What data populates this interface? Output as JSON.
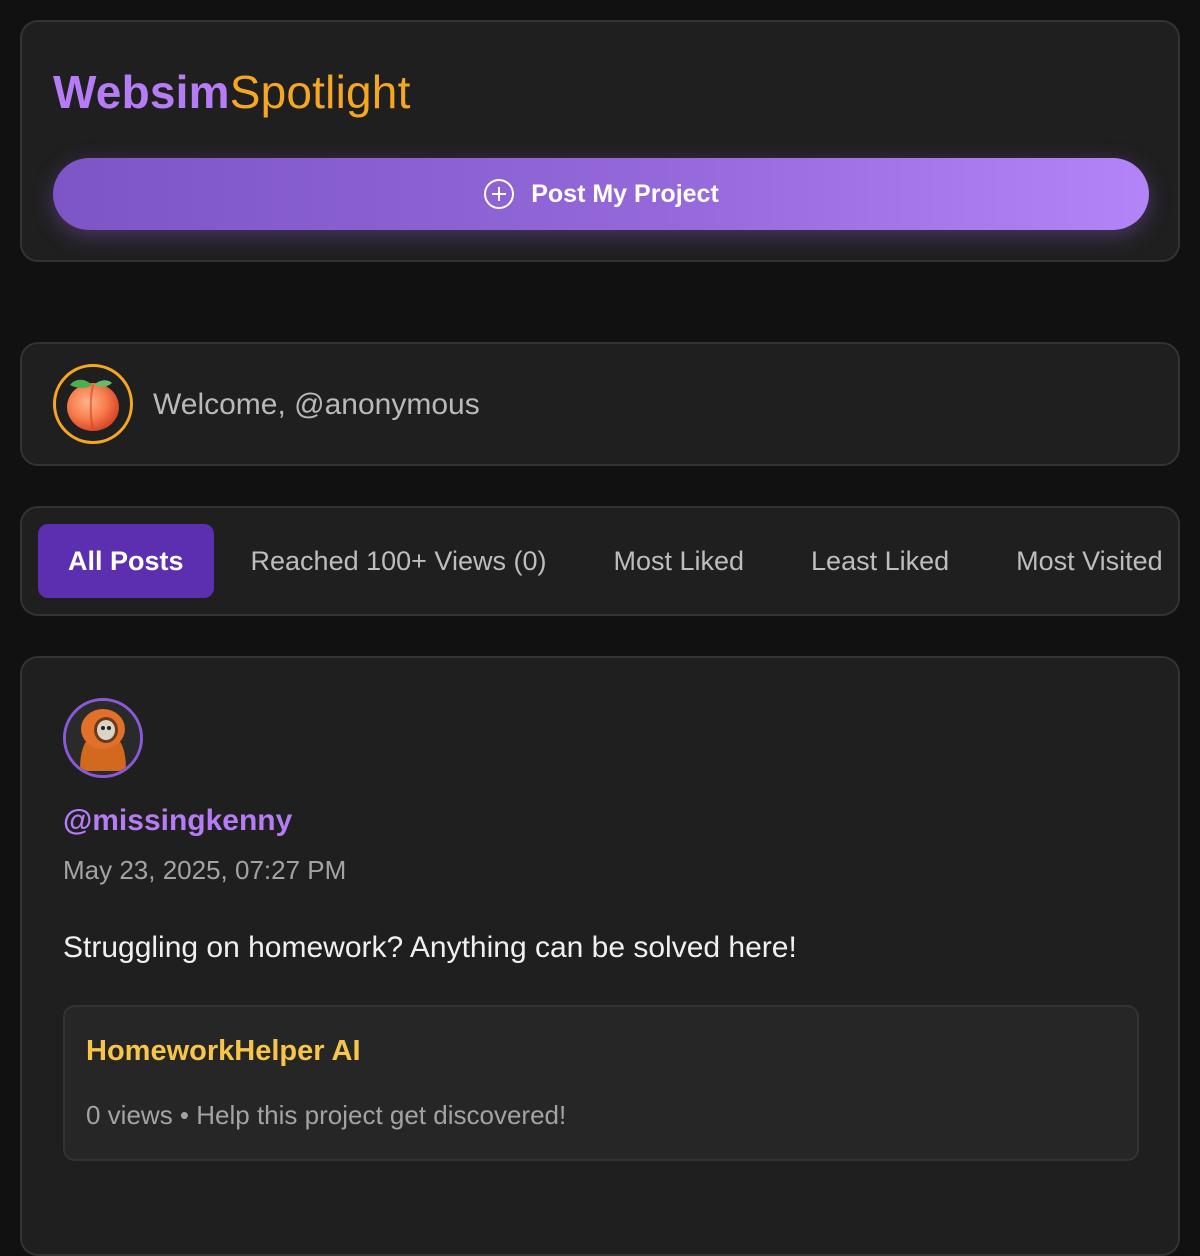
{
  "header": {
    "brand_part1": "Websim",
    "brand_part2": "Spotlight",
    "post_button_label": "Post My Project",
    "post_button_icon": "plus-circle-icon"
  },
  "welcome": {
    "avatar_icon": "peach-icon",
    "text": "Welcome, @anonymous"
  },
  "tabs": [
    {
      "label": "All Posts",
      "active": true
    },
    {
      "label": "Reached 100+ Views (0)",
      "active": false
    },
    {
      "label": "Most Liked",
      "active": false
    },
    {
      "label": "Least Liked",
      "active": false
    },
    {
      "label": "Most Visited",
      "active": false
    }
  ],
  "post": {
    "username": "@missingkenny",
    "timestamp": "May 23, 2025, 07:27 PM",
    "body": "Struggling on homework? Anything can be solved here!",
    "project": {
      "title": "HomeworkHelper AI",
      "meta": "0 views • Help this project get discovered!"
    }
  },
  "colors": {
    "background": "#111111",
    "card": "#1f1f1f",
    "accent_purple": "#b57cf5",
    "accent_orange": "#f5a623",
    "active_tab": "#5b2fb0",
    "project_title": "#f7c54a"
  }
}
